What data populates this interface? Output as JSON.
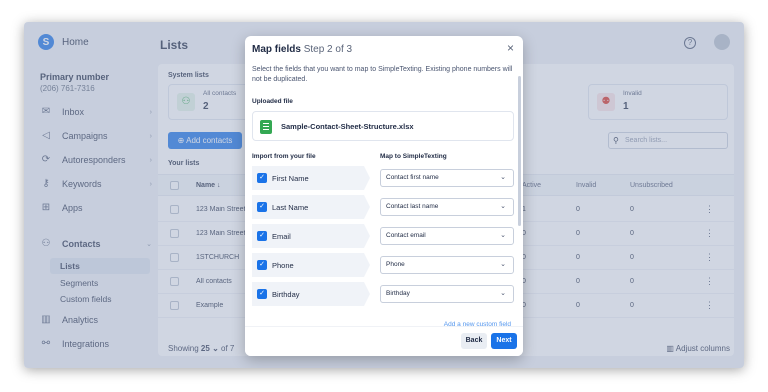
{
  "sidebar": {
    "home_label": "Home",
    "primary_label": "Primary number",
    "primary_number": "(206) 761-7316",
    "items": [
      {
        "label": "Inbox",
        "icon": "inbox-icon",
        "glyph": "✉"
      },
      {
        "label": "Campaigns",
        "icon": "megaphone-icon",
        "glyph": "📢"
      },
      {
        "label": "Autoresponders",
        "icon": "autoresponder-icon",
        "glyph": "⟳"
      },
      {
        "label": "Keywords",
        "icon": "key-icon",
        "glyph": "⚷"
      },
      {
        "label": "Apps",
        "icon": "apps-grid-icon",
        "glyph": "⊞"
      },
      {
        "label": "Contacts",
        "icon": "contacts-icon",
        "glyph": "👥"
      },
      {
        "label": "Analytics",
        "icon": "analytics-icon",
        "glyph": "▥"
      },
      {
        "label": "Integrations",
        "icon": "integrations-icon",
        "glyph": "⚯"
      }
    ],
    "sub_items": [
      "Lists",
      "Segments",
      "Custom fields"
    ]
  },
  "header": {
    "title": "Lists"
  },
  "system_lists": {
    "label": "System lists",
    "stats": [
      {
        "label": "All contacts",
        "value": "2",
        "color": "#34a853"
      },
      {
        "label": "Invalid",
        "value": "1",
        "color": "#d93025"
      }
    ]
  },
  "toolbar": {
    "add_contacts": "Add contacts",
    "search_placeholder": "Search lists..."
  },
  "table": {
    "your_lists": "Your lists",
    "columns": [
      "Name",
      "Active",
      "Invalid",
      "Unsubscribed"
    ],
    "rows": [
      {
        "name": "123 Main Street",
        "active": "1",
        "invalid": "0",
        "unsub": "0"
      },
      {
        "name": "123 Main Street",
        "active": "0",
        "invalid": "0",
        "unsub": "0"
      },
      {
        "name": "1STCHURCH",
        "active": "0",
        "invalid": "0",
        "unsub": "0"
      },
      {
        "name": "All contacts",
        "active": "0",
        "invalid": "0",
        "unsub": "0"
      },
      {
        "name": "Example",
        "active": "0",
        "invalid": "0",
        "unsub": "0"
      }
    ],
    "showing_label": "Showing",
    "showing_count": "25",
    "of_label": "of 7",
    "adjust_columns": "Adjust columns"
  },
  "modal": {
    "title": "Map fields",
    "step": "Step 2 of 3",
    "description": "Select the fields that you want to map to SimpleTexting. Existing phone numbers will not be duplicated.",
    "uploaded_label": "Uploaded file",
    "file_name": "Sample-Contact-Sheet-Structure.xlsx",
    "import_header": "Import from your file",
    "map_header": "Map to SimpleTexting",
    "fields": [
      {
        "source": "First Name",
        "target": "Contact first name"
      },
      {
        "source": "Last Name",
        "target": "Contact last name"
      },
      {
        "source": "Email",
        "target": "Contact email"
      },
      {
        "source": "Phone",
        "target": "Phone"
      },
      {
        "source": "Birthday",
        "target": "Birthday"
      }
    ],
    "add_custom": "Add a new custom field",
    "back_label": "Back",
    "next_label": "Next"
  },
  "colors": {
    "accent": "#1a73e8",
    "sheet": "#34a853"
  }
}
